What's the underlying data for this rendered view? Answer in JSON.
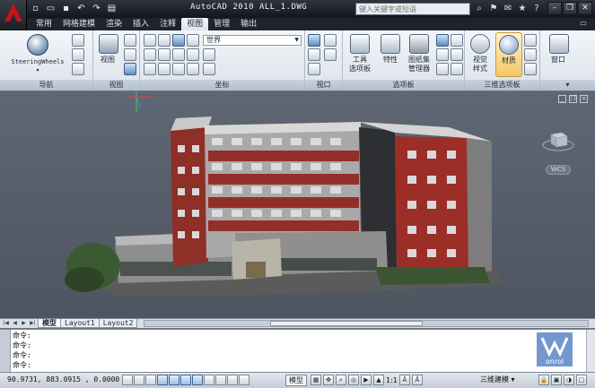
{
  "titlebar": {
    "title": "AutoCAD 2010   ALL_1.DWG",
    "search_placeholder": "键入关键字或短语",
    "quick_access": [
      "new-icon",
      "open-icon",
      "save-icon",
      "undo-icon",
      "redo-icon",
      "plot-icon"
    ]
  },
  "tabs": [
    "常用",
    "网格建模",
    "渲染",
    "插入",
    "注释",
    "视图",
    "管理",
    "输出"
  ],
  "active_tab": "视图",
  "ribbon": {
    "panels": {
      "navigation": {
        "title": "导航",
        "steering": "SteeringWheels"
      },
      "views": {
        "title": "视图",
        "button": "视图"
      },
      "coordinates": {
        "title": "坐标",
        "ucs_dropdown": "世界"
      },
      "viewports": {
        "title": "视口"
      },
      "palettes": {
        "title": "选项板",
        "tool_palettes": "工具\n选项板",
        "properties": "特性",
        "sheet_set": "图纸集\n管理器"
      },
      "palettes_3d": {
        "title": "三维选项板",
        "visual_styles": "视觉\n样式",
        "materials": "材质"
      },
      "window": {
        "title": "",
        "button": "窗口"
      }
    }
  },
  "viewport": {
    "ucs_label": "WCS",
    "viewcube_face": "上"
  },
  "layout_tabs": [
    "模型",
    "Layout1",
    "Layout2"
  ],
  "active_layout": "模型",
  "command_line": {
    "lines": [
      "命令:",
      "命令:",
      "命令:",
      "命令:"
    ]
  },
  "statusbar": {
    "coordinates": "90.9731, 883.0915 , 0.0000",
    "model_label": "模型",
    "annotation_scale": "1:1",
    "workspace": "三维建模"
  },
  "watermark": "onrol",
  "colors": {
    "title_bg": "#1b1f26",
    "ribbon_bg": "#e3e8ee",
    "viewport_bg": "#565f6b",
    "brick": "#9b2a24",
    "active_tab": "#eef2f6"
  }
}
